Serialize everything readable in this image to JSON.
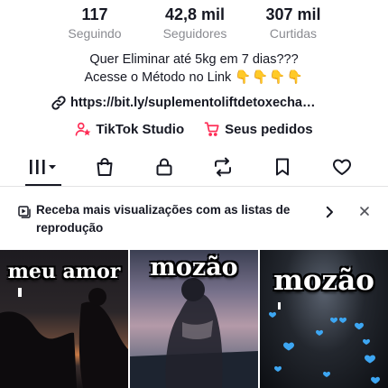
{
  "stats": {
    "following": {
      "value": "117",
      "label": "Seguindo"
    },
    "followers": {
      "value": "42,8 mil",
      "label": "Seguidores"
    },
    "likes": {
      "value": "307 mil",
      "label": "Curtidas"
    }
  },
  "bio": {
    "line1": "Quer Eliminar até 5kg em 7 dias???",
    "line2": "Acesse o Método no Link",
    "emojis": "👇👇👇👇"
  },
  "link": {
    "text": "https://bit.ly/suplementoliftdetoxecha…",
    "icon": "link-icon"
  },
  "tools": [
    {
      "label": "TikTok Studio",
      "icon": "person-star-icon",
      "color": "#fe2c55"
    },
    {
      "label": "Seus pedidos",
      "icon": "cart-icon",
      "color": "#fe2c55"
    }
  ],
  "tabs": [
    {
      "name": "videos-grid",
      "icon": "grid-bars-icon",
      "active": true
    },
    {
      "name": "shop",
      "icon": "shopping-bag-icon"
    },
    {
      "name": "private",
      "icon": "lock-icon"
    },
    {
      "name": "reposts",
      "icon": "repost-icon"
    },
    {
      "name": "favorites",
      "icon": "bookmark-icon"
    },
    {
      "name": "liked",
      "icon": "heart-icon"
    }
  ],
  "banner": {
    "text": "Receba mais visualizações com as listas de reprodução",
    "icon": "playlist-icon"
  },
  "videos": [
    {
      "caption": "meu amor"
    },
    {
      "caption": "mozão"
    },
    {
      "caption": "mozão"
    }
  ],
  "colors": {
    "accent": "#fe2c55",
    "text": "#161823",
    "muted": "#8a8b91"
  }
}
